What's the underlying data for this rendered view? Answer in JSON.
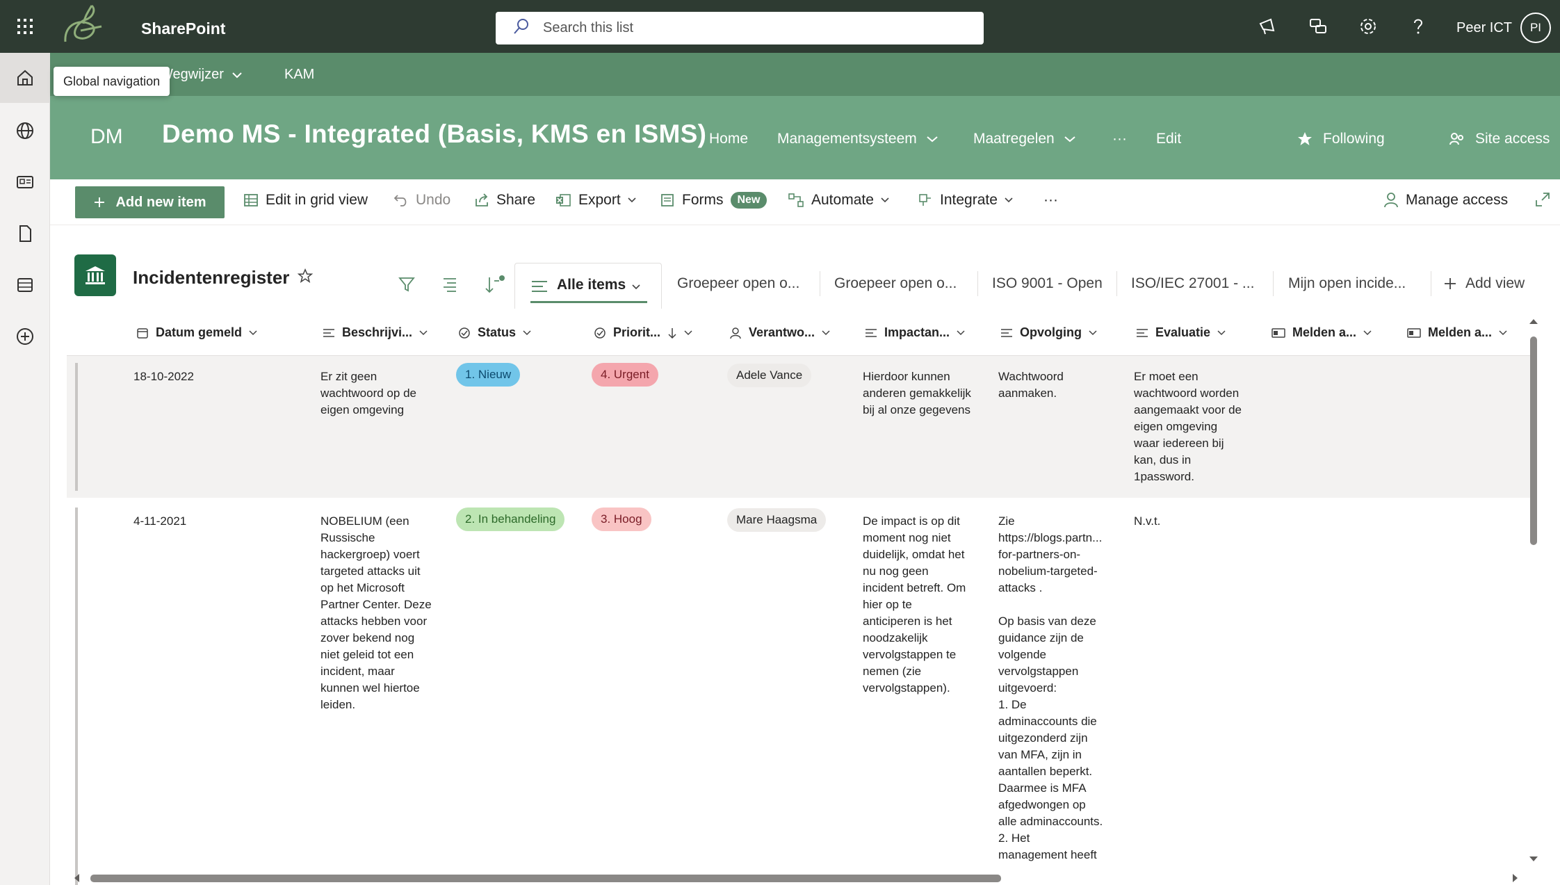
{
  "suite": {
    "brand": "SharePoint",
    "search_placeholder": "Search this list",
    "user_name": "Peer ICT",
    "user_initials": "PI"
  },
  "hub": {
    "tooltip": "Global navigation",
    "items": [
      "Wegwijzer",
      "KAM"
    ]
  },
  "site": {
    "logo": "DM",
    "title": "Demo MS - Integrated (Basis, KMS en ISMS)",
    "nav": [
      "Home",
      "Managementsysteem",
      "Maatregelen",
      "···",
      "Edit"
    ],
    "following": "Following",
    "site_access": "Site access"
  },
  "commands": {
    "add_new_item": "Add new item",
    "edit_grid": "Edit in grid view",
    "undo": "Undo",
    "share": "Share",
    "export": "Export",
    "forms": "Forms",
    "forms_badge": "New",
    "automate": "Automate",
    "integrate": "Integrate",
    "more": "···",
    "manage_access": "Manage access"
  },
  "list": {
    "title": "Incidentenregister",
    "views": {
      "active": "Alle items",
      "others": [
        "Groepeer open o...",
        "Groepeer open o...",
        "ISO 9001 - Open",
        "ISO/IEC 27001 - ...",
        "Mijn open incide..."
      ],
      "add_view": "Add view"
    },
    "columns": [
      "Datum gemeld",
      "Beschrijvi...",
      "Status",
      "Priorit...",
      "Verantwo...",
      "Impactan...",
      "Opvolging",
      "Evaluatie",
      "Melden a...",
      "Melden a..."
    ],
    "rows": [
      {
        "datum": "18-10-2022",
        "beschrijving": "Er zit geen\nwachtwoord op de\neigen omgeving",
        "status": "1. Nieuw",
        "prioriteit": "4. Urgent",
        "verantwoordelijke": "Adele Vance",
        "impact": "Hierdoor kunnen\nanderen gemakkelijk\nbij al onze gegevens",
        "opvolging": "Wachtwoord\naanmaken.",
        "evaluatie": "Er moet een\nwachtwoord worden\naangemaakt voor de\neigen omgeving\nwaar iedereen bij\nkan, dus in\n1password."
      },
      {
        "datum": "4-11-2021",
        "beschrijving": "NOBELIUM (een\nRussische\nhackergroep) voert\ntargeted attacks uit\nop het Microsoft\nPartner Center. Deze\nattacks hebben voor\nzover bekend nog\nniet geleid tot een\nincident, maar\nkunnen wel hiertoe\nleiden.",
        "status": "2. In behandeling",
        "prioriteit": "3. Hoog",
        "verantwoordelijke": "Mare Haagsma",
        "impact": "De impact is op dit\nmoment nog niet\nduidelijk, omdat het\nnu nog geen\nincident betreft. Om\nhier op te\nanticiperen is het\nnoodzakelijk\nvervolgstappen te\nnemen (zie\nvervolgstappen).",
        "opvolging": "Zie\nhttps://blogs.partn...\nfor-partners-on-\nnobelium-targeted-\nattacks .\n\nOp basis van deze\nguidance zijn de\nvolgende\nvervolgstappen\nuitgevoerd:\n  1. De\nadminaccounts die\nuitgezonderd zijn\nvan MFA, zijn in\naantallen beperkt.\nDaarmee is MFA\nafgedwongen op\nalle adminaccounts.\n  2. Het\nmanagement heeft",
        "evaluatie": "N.v.t."
      }
    ]
  },
  "colors": {
    "suitebar": "#2e3b32",
    "hubnav": "#5a8c6b",
    "siteheader": "#6fa684",
    "accent": "#5a8c6b"
  }
}
